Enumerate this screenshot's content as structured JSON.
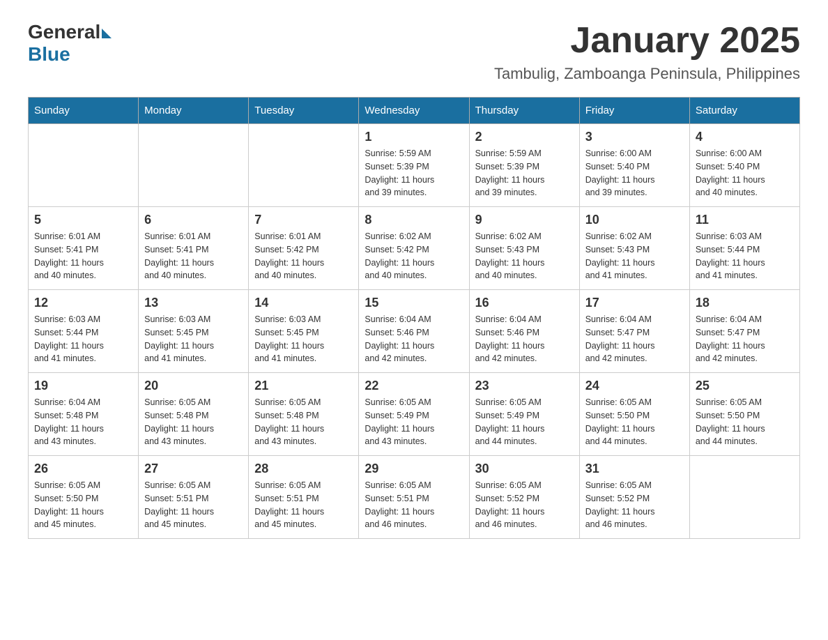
{
  "logo": {
    "general": "General",
    "blue": "Blue"
  },
  "title": "January 2025",
  "subtitle": "Tambulig, Zamboanga Peninsula, Philippines",
  "headers": [
    "Sunday",
    "Monday",
    "Tuesday",
    "Wednesday",
    "Thursday",
    "Friday",
    "Saturday"
  ],
  "weeks": [
    [
      {
        "day": "",
        "info": ""
      },
      {
        "day": "",
        "info": ""
      },
      {
        "day": "",
        "info": ""
      },
      {
        "day": "1",
        "info": "Sunrise: 5:59 AM\nSunset: 5:39 PM\nDaylight: 11 hours\nand 39 minutes."
      },
      {
        "day": "2",
        "info": "Sunrise: 5:59 AM\nSunset: 5:39 PM\nDaylight: 11 hours\nand 39 minutes."
      },
      {
        "day": "3",
        "info": "Sunrise: 6:00 AM\nSunset: 5:40 PM\nDaylight: 11 hours\nand 39 minutes."
      },
      {
        "day": "4",
        "info": "Sunrise: 6:00 AM\nSunset: 5:40 PM\nDaylight: 11 hours\nand 40 minutes."
      }
    ],
    [
      {
        "day": "5",
        "info": "Sunrise: 6:01 AM\nSunset: 5:41 PM\nDaylight: 11 hours\nand 40 minutes."
      },
      {
        "day": "6",
        "info": "Sunrise: 6:01 AM\nSunset: 5:41 PM\nDaylight: 11 hours\nand 40 minutes."
      },
      {
        "day": "7",
        "info": "Sunrise: 6:01 AM\nSunset: 5:42 PM\nDaylight: 11 hours\nand 40 minutes."
      },
      {
        "day": "8",
        "info": "Sunrise: 6:02 AM\nSunset: 5:42 PM\nDaylight: 11 hours\nand 40 minutes."
      },
      {
        "day": "9",
        "info": "Sunrise: 6:02 AM\nSunset: 5:43 PM\nDaylight: 11 hours\nand 40 minutes."
      },
      {
        "day": "10",
        "info": "Sunrise: 6:02 AM\nSunset: 5:43 PM\nDaylight: 11 hours\nand 41 minutes."
      },
      {
        "day": "11",
        "info": "Sunrise: 6:03 AM\nSunset: 5:44 PM\nDaylight: 11 hours\nand 41 minutes."
      }
    ],
    [
      {
        "day": "12",
        "info": "Sunrise: 6:03 AM\nSunset: 5:44 PM\nDaylight: 11 hours\nand 41 minutes."
      },
      {
        "day": "13",
        "info": "Sunrise: 6:03 AM\nSunset: 5:45 PM\nDaylight: 11 hours\nand 41 minutes."
      },
      {
        "day": "14",
        "info": "Sunrise: 6:03 AM\nSunset: 5:45 PM\nDaylight: 11 hours\nand 41 minutes."
      },
      {
        "day": "15",
        "info": "Sunrise: 6:04 AM\nSunset: 5:46 PM\nDaylight: 11 hours\nand 42 minutes."
      },
      {
        "day": "16",
        "info": "Sunrise: 6:04 AM\nSunset: 5:46 PM\nDaylight: 11 hours\nand 42 minutes."
      },
      {
        "day": "17",
        "info": "Sunrise: 6:04 AM\nSunset: 5:47 PM\nDaylight: 11 hours\nand 42 minutes."
      },
      {
        "day": "18",
        "info": "Sunrise: 6:04 AM\nSunset: 5:47 PM\nDaylight: 11 hours\nand 42 minutes."
      }
    ],
    [
      {
        "day": "19",
        "info": "Sunrise: 6:04 AM\nSunset: 5:48 PM\nDaylight: 11 hours\nand 43 minutes."
      },
      {
        "day": "20",
        "info": "Sunrise: 6:05 AM\nSunset: 5:48 PM\nDaylight: 11 hours\nand 43 minutes."
      },
      {
        "day": "21",
        "info": "Sunrise: 6:05 AM\nSunset: 5:48 PM\nDaylight: 11 hours\nand 43 minutes."
      },
      {
        "day": "22",
        "info": "Sunrise: 6:05 AM\nSunset: 5:49 PM\nDaylight: 11 hours\nand 43 minutes."
      },
      {
        "day": "23",
        "info": "Sunrise: 6:05 AM\nSunset: 5:49 PM\nDaylight: 11 hours\nand 44 minutes."
      },
      {
        "day": "24",
        "info": "Sunrise: 6:05 AM\nSunset: 5:50 PM\nDaylight: 11 hours\nand 44 minutes."
      },
      {
        "day": "25",
        "info": "Sunrise: 6:05 AM\nSunset: 5:50 PM\nDaylight: 11 hours\nand 44 minutes."
      }
    ],
    [
      {
        "day": "26",
        "info": "Sunrise: 6:05 AM\nSunset: 5:50 PM\nDaylight: 11 hours\nand 45 minutes."
      },
      {
        "day": "27",
        "info": "Sunrise: 6:05 AM\nSunset: 5:51 PM\nDaylight: 11 hours\nand 45 minutes."
      },
      {
        "day": "28",
        "info": "Sunrise: 6:05 AM\nSunset: 5:51 PM\nDaylight: 11 hours\nand 45 minutes."
      },
      {
        "day": "29",
        "info": "Sunrise: 6:05 AM\nSunset: 5:51 PM\nDaylight: 11 hours\nand 46 minutes."
      },
      {
        "day": "30",
        "info": "Sunrise: 6:05 AM\nSunset: 5:52 PM\nDaylight: 11 hours\nand 46 minutes."
      },
      {
        "day": "31",
        "info": "Sunrise: 6:05 AM\nSunset: 5:52 PM\nDaylight: 11 hours\nand 46 minutes."
      },
      {
        "day": "",
        "info": ""
      }
    ]
  ]
}
